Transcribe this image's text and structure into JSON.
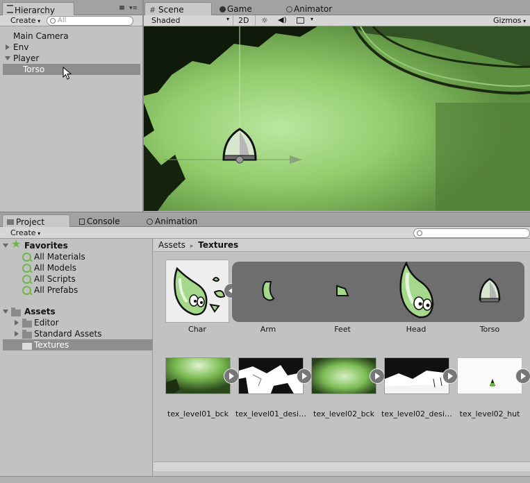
{
  "hierarchy": {
    "tab_label": "Hierarchy",
    "create_label": "Create",
    "search_placeholder": "All",
    "items": [
      {
        "label": "Main Camera"
      },
      {
        "label": "Env"
      },
      {
        "label": "Player"
      },
      {
        "label": "Torso"
      }
    ]
  },
  "scene_tabs": {
    "scene": "Scene",
    "game": "Game",
    "animator": "Animator"
  },
  "scene_toolbar": {
    "shading_mode": "Shaded",
    "mode_2d": "2D",
    "gizmos": "Gizmos"
  },
  "bottom_tabs": {
    "project": "Project",
    "console": "Console",
    "animation": "Animation"
  },
  "project": {
    "create_label": "Create",
    "favorites": {
      "label": "Favorites",
      "items": [
        "All Materials",
        "All Models",
        "All Scripts",
        "All Prefabs"
      ]
    },
    "assets": {
      "label": "Assets",
      "items": [
        "Editor",
        "Standard Assets",
        "Textures"
      ]
    },
    "breadcrumb": {
      "root": "Assets",
      "separator": "▸",
      "current": "Textures"
    },
    "sprites": {
      "parent": "Char",
      "children": [
        "Arm",
        "Feet",
        "Head",
        "Torso"
      ]
    },
    "textures": [
      "tex_level01_bck",
      "tex_level01_desi…",
      "tex_level02_bck",
      "tex_level02_desi…",
      "tex_level02_hut"
    ]
  },
  "colors": {
    "selection": "#8e8e8e",
    "scene_green": "#6a9a4c",
    "sprite_strip": "#6e6e6e"
  }
}
